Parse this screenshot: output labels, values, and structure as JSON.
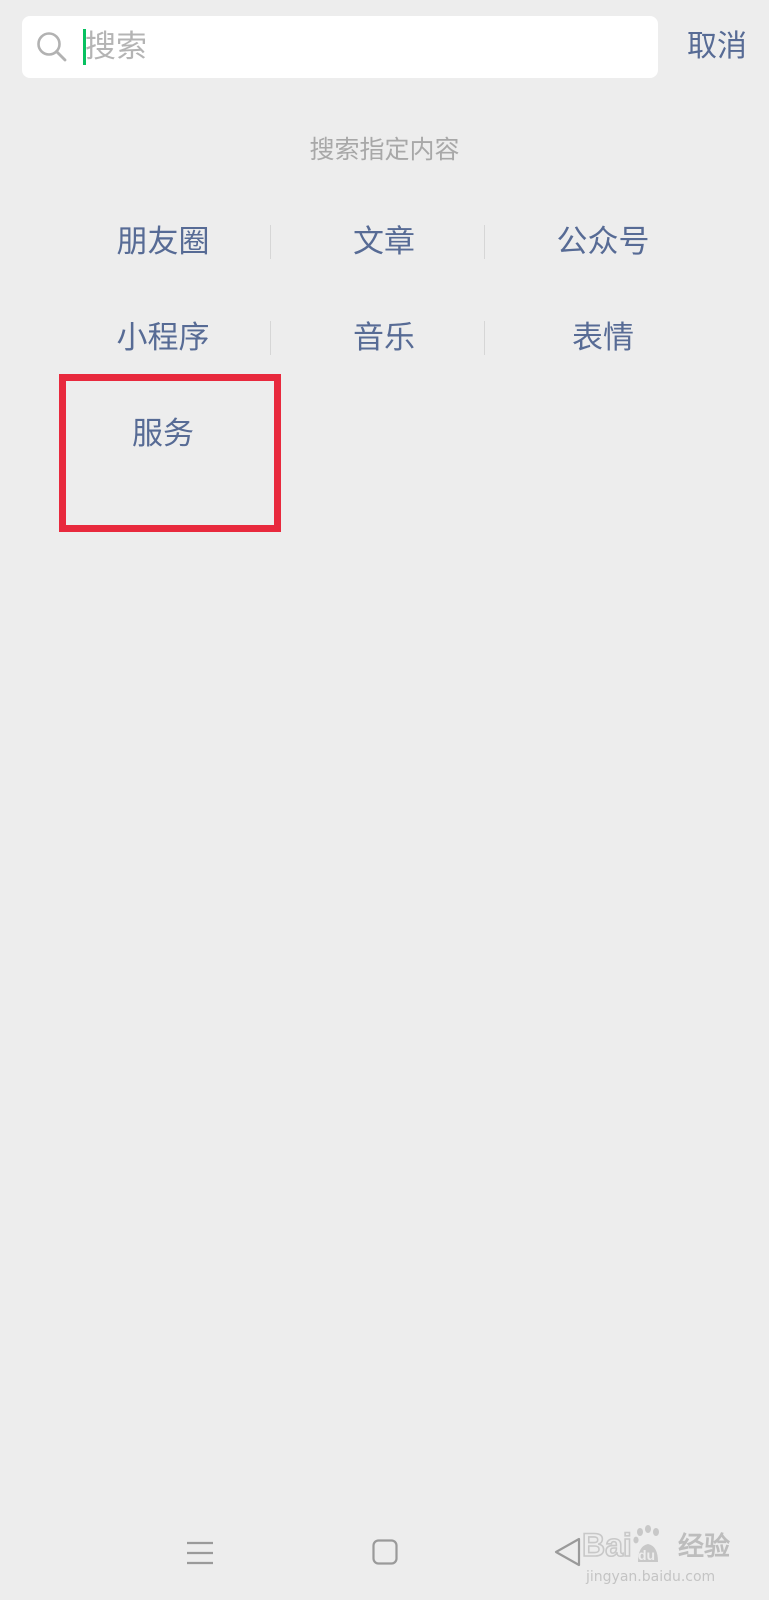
{
  "search": {
    "placeholder": "搜索",
    "cancel_label": "取消"
  },
  "section": {
    "title": "搜索指定内容"
  },
  "categories": [
    {
      "label": "朋友圈"
    },
    {
      "label": "文章"
    },
    {
      "label": "公众号"
    },
    {
      "label": "小程序"
    },
    {
      "label": "音乐"
    },
    {
      "label": "表情"
    },
    {
      "label": "服务"
    }
  ],
  "nav": {
    "menu_icon": "menu-icon",
    "home_icon": "home-icon",
    "back_icon": "back-icon"
  },
  "watermark": {
    "logo_text": "Baidu",
    "cn_text": "经验",
    "url": "jingyan.baidu.com"
  },
  "colors": {
    "accent_link": "#576b95",
    "caret": "#07c160",
    "highlight": "#e8293d",
    "background": "#ededed"
  }
}
